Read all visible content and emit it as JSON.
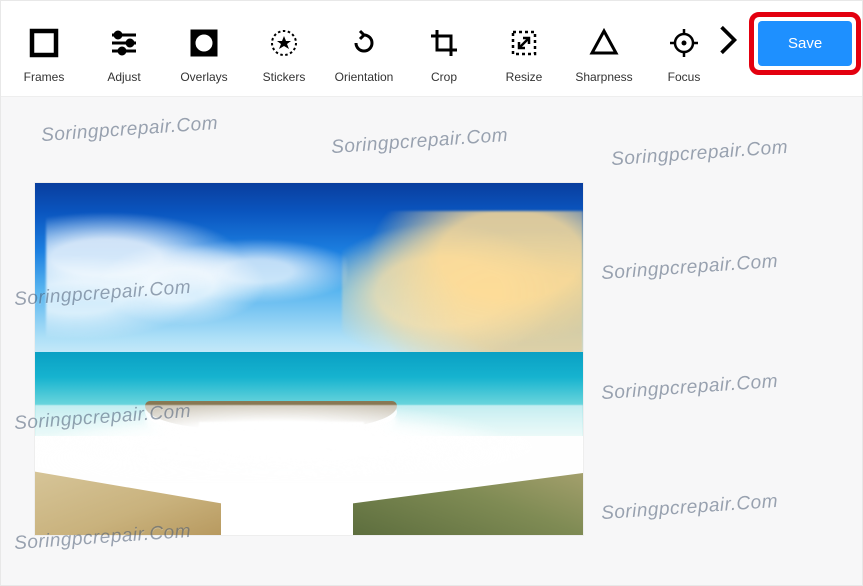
{
  "toolbar": {
    "tools": [
      {
        "id": "frames",
        "label": "Frames"
      },
      {
        "id": "adjust",
        "label": "Adjust"
      },
      {
        "id": "overlays",
        "label": "Overlays"
      },
      {
        "id": "stickers",
        "label": "Stickers"
      },
      {
        "id": "orientation",
        "label": "Orientation"
      },
      {
        "id": "crop",
        "label": "Crop"
      },
      {
        "id": "resize",
        "label": "Resize"
      },
      {
        "id": "sharpness",
        "label": "Sharpness"
      },
      {
        "id": "focus",
        "label": "Focus"
      }
    ],
    "next_icon": "chevron-right",
    "save_label": "Save"
  },
  "highlight": {
    "target": "save-button",
    "border_color": "#e3000f"
  },
  "colors": {
    "accent": "#1e90ff",
    "toolbar_bg": "#ffffff",
    "canvas_bg": "#f7f7f8"
  },
  "watermark": {
    "text": "Soringpcrepair.Com"
  }
}
